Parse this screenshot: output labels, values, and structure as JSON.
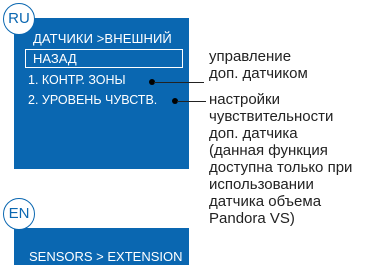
{
  "badges": {
    "ru": "RU",
    "en": "EN"
  },
  "screen_ru": {
    "header": "ДАТЧИКИ >ВНЕШНИЙ",
    "back_label": "НАЗАД",
    "items": [
      {
        "label": "1. КОНТР. ЗОНЫ"
      },
      {
        "label": "2. УРОВЕНЬ ЧУВСТВ."
      }
    ]
  },
  "screen_en": {
    "header": "SENSORS > EXTENSION"
  },
  "callouts": [
    {
      "text": "управление\nдоп. датчиком"
    },
    {
      "text": "настройки\nчувствительности\nдоп. датчика\n(данная функция\nдоступна только при\nиспользовании\nдатчика объема\nPandora VS)"
    }
  ],
  "colors": {
    "screen_background": "#0a67b1",
    "screen_text": "#ffffff",
    "callout_text": "#222222"
  }
}
